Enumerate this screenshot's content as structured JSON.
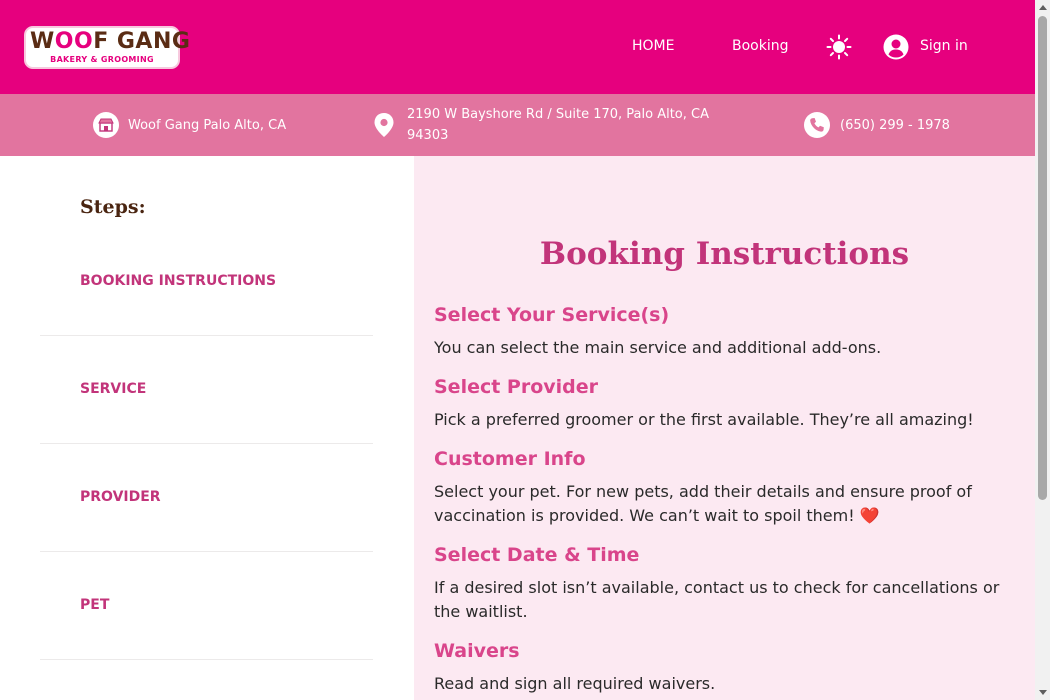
{
  "header": {
    "logo": {
      "text_part1": "W",
      "text_paws": "OO",
      "text_part2": "F GANG",
      "subtitle": "BAKERY & GROOMING"
    },
    "nav": {
      "home": "HOME",
      "booking": "Booking",
      "signin": "Sign in"
    },
    "icons": {
      "theme": "sun-icon",
      "user": "user-circle-icon"
    },
    "brand_color": "#e6007e"
  },
  "info_bar": {
    "store": "Woof Gang Palo Alto, CA",
    "address": "2190 W Bayshore Rd / Suite 170, Palo Alto, CA 94303",
    "phone": "(650) 299 - 1978",
    "color": "#e2749f"
  },
  "sidebar": {
    "title": "Steps:",
    "steps": [
      {
        "label": "BOOKING INSTRUCTIONS"
      },
      {
        "label": "SERVICE"
      },
      {
        "label": "PROVIDER"
      },
      {
        "label": "PET"
      }
    ]
  },
  "main": {
    "title": "Booking Instructions",
    "sections": [
      {
        "heading": "Select Your Service(s)",
        "body": "You can select the main service and additional add-ons."
      },
      {
        "heading": "Select Provider",
        "body": "Pick a preferred groomer or the first available. They’re all amazing!"
      },
      {
        "heading": "Customer Info",
        "body": "Select your pet. For new pets, add their details and ensure proof of vaccination is provided. We can’t wait to spoil them! ❤️"
      },
      {
        "heading": "Select Date & Time",
        "body": "If a desired slot isn’t available, contact us to check for cancellations or the waitlist."
      },
      {
        "heading": "Waivers",
        "body": "Read and sign all required waivers."
      }
    ]
  }
}
